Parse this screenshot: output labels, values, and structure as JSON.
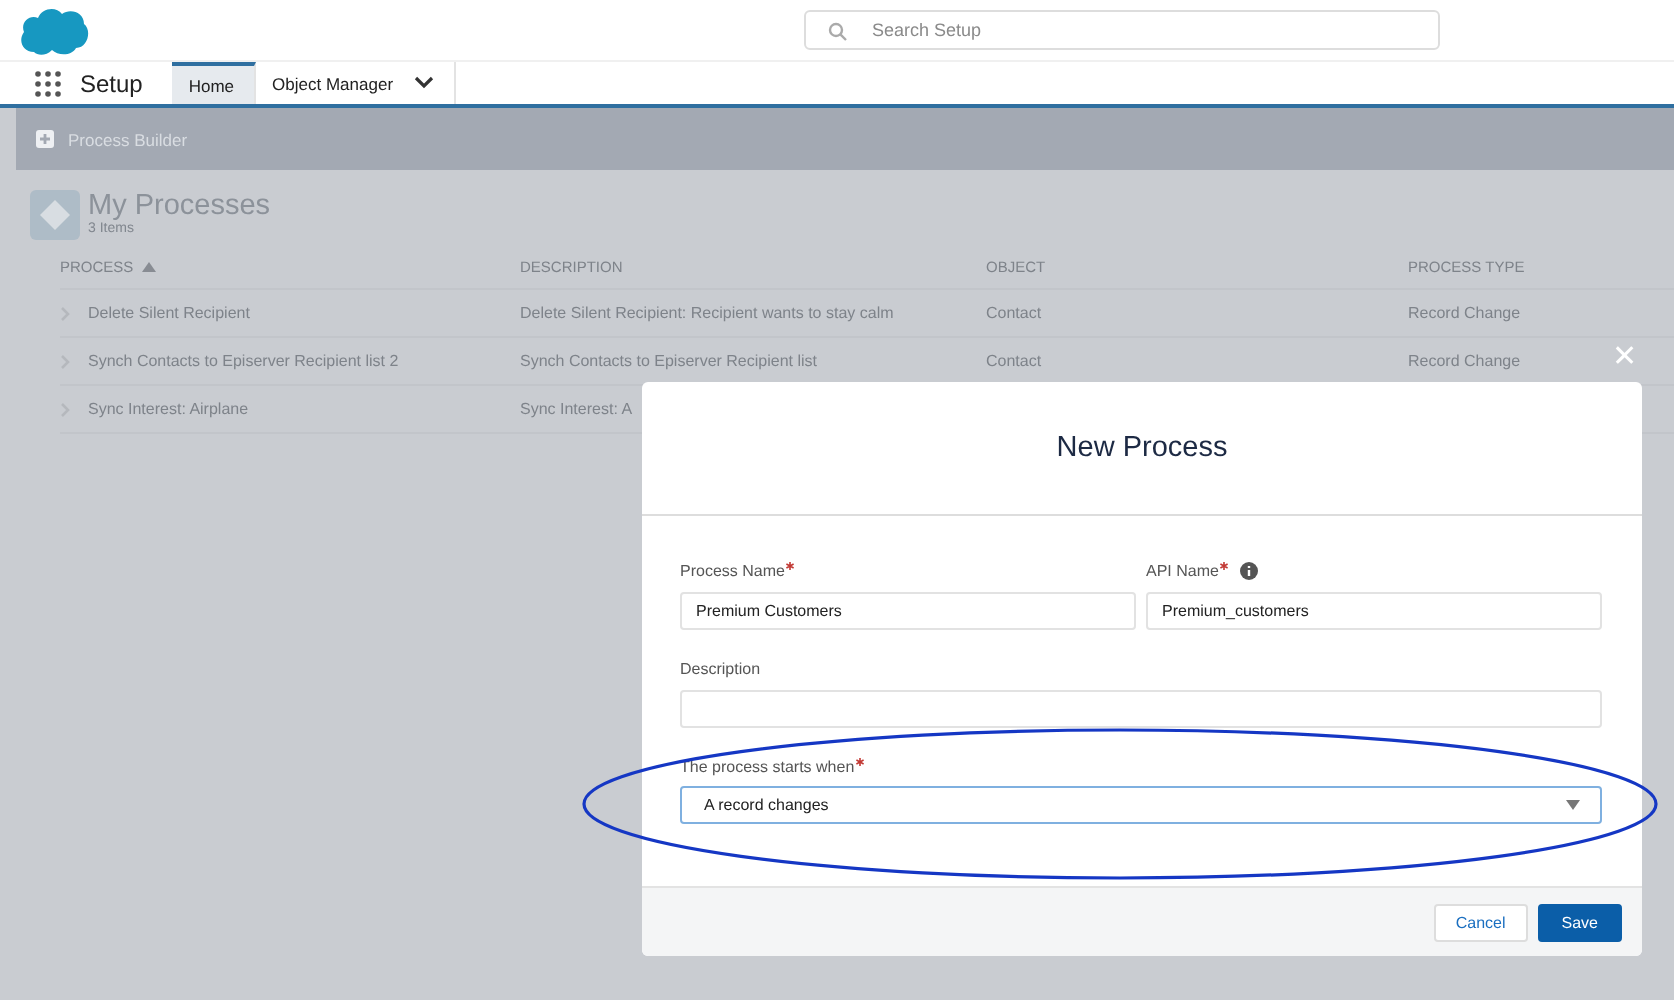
{
  "header": {
    "search": {
      "placeholder": "Search Setup"
    }
  },
  "nav": {
    "app_name": "Setup",
    "tabs": [
      {
        "label": "Home",
        "selected": true,
        "has_menu": false
      },
      {
        "label": "Object Manager",
        "selected": false,
        "has_menu": true
      }
    ]
  },
  "page_bar": {
    "title": "Process Builder"
  },
  "list_header": {
    "title": "My Processes",
    "subtitle": "3 Items"
  },
  "table": {
    "columns": [
      {
        "label": "PROCESS",
        "sorted": true
      },
      {
        "label": "DESCRIPTION",
        "sorted": false
      },
      {
        "label": "OBJECT",
        "sorted": false
      },
      {
        "label": "PROCESS TYPE",
        "sorted": false
      }
    ],
    "rows": [
      {
        "cells": [
          "Delete Silent Recipient",
          "Delete Silent Recipient: Recipient wants to stay calm",
          "Contact",
          "Record Change"
        ]
      },
      {
        "cells": [
          "Synch Contacts to Episerver Recipient list 2",
          "Synch Contacts to Episerver Recipient list",
          "Contact",
          "Record Change"
        ]
      },
      {
        "cells": [
          "Sync Interest: Airplane",
          "Sync Interest: A"
        ]
      }
    ]
  },
  "modal": {
    "title": "New Process",
    "field_rows": [
      [
        {
          "label": "Process Name",
          "required": true,
          "info": false,
          "kind": "text",
          "value": "Premium Customers"
        },
        {
          "label": "API Name",
          "required": true,
          "info": true,
          "kind": "text",
          "value": "Premium_customers"
        }
      ],
      [
        {
          "label": "Description",
          "required": false,
          "info": false,
          "kind": "text"
        }
      ],
      [
        {
          "label": "The process starts when",
          "required": true,
          "info": false,
          "kind": "select",
          "value": "A record changes"
        }
      ]
    ],
    "buttons": [
      {
        "label": "Cancel",
        "kind": "neutral"
      },
      {
        "label": "Save",
        "kind": "brand"
      }
    ],
    "close": "✕"
  }
}
